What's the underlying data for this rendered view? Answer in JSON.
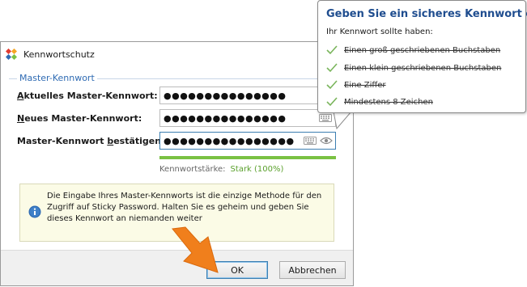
{
  "window": {
    "title": "Kennwortschutz"
  },
  "group": {
    "legend": "Master-Kennwort"
  },
  "fields": [
    {
      "label_pre": "",
      "label_key": "A",
      "label_post": "ktuelles Master-Kennwort:",
      "value": "●●●●●●●●●●●●●●●"
    },
    {
      "label_pre": "",
      "label_key": "N",
      "label_post": "eues Master-Kennwort:",
      "value": "●●●●●●●●●●●●●●●"
    },
    {
      "label_pre": "Master-Kennwort ",
      "label_key": "b",
      "label_post": "estätigen:",
      "value": "●●●●●●●●●●●●●●●●"
    }
  ],
  "strength": {
    "label": "Kennwortstärke:",
    "value": "Stark (100%)",
    "level": 1.0
  },
  "info": {
    "text": "Die Eingabe Ihres Master-Kennworts ist die einzige Methode für den Zugriff auf Sticky Password. Halten Sie es geheim und geben Sie dieses Kennwort an niemanden weiter"
  },
  "buttons": {
    "ok": "OK",
    "cancel": "Abbrechen"
  },
  "tooltip": {
    "title": "Geben Sie ein sicheres Kennwort ein",
    "subtitle": "Ihr Kennwort sollte haben:",
    "items": [
      "Einen groß geschriebenen Buchstaben",
      "Einen klein geschriebenen Buchstaben",
      "Eine Ziffer",
      "Mindestens 8 Zeichen"
    ]
  },
  "colors": {
    "accent": "#1f4d8f",
    "strength": "#7ac143",
    "check": "#7ab55c",
    "arrow": "#f07f1c"
  }
}
